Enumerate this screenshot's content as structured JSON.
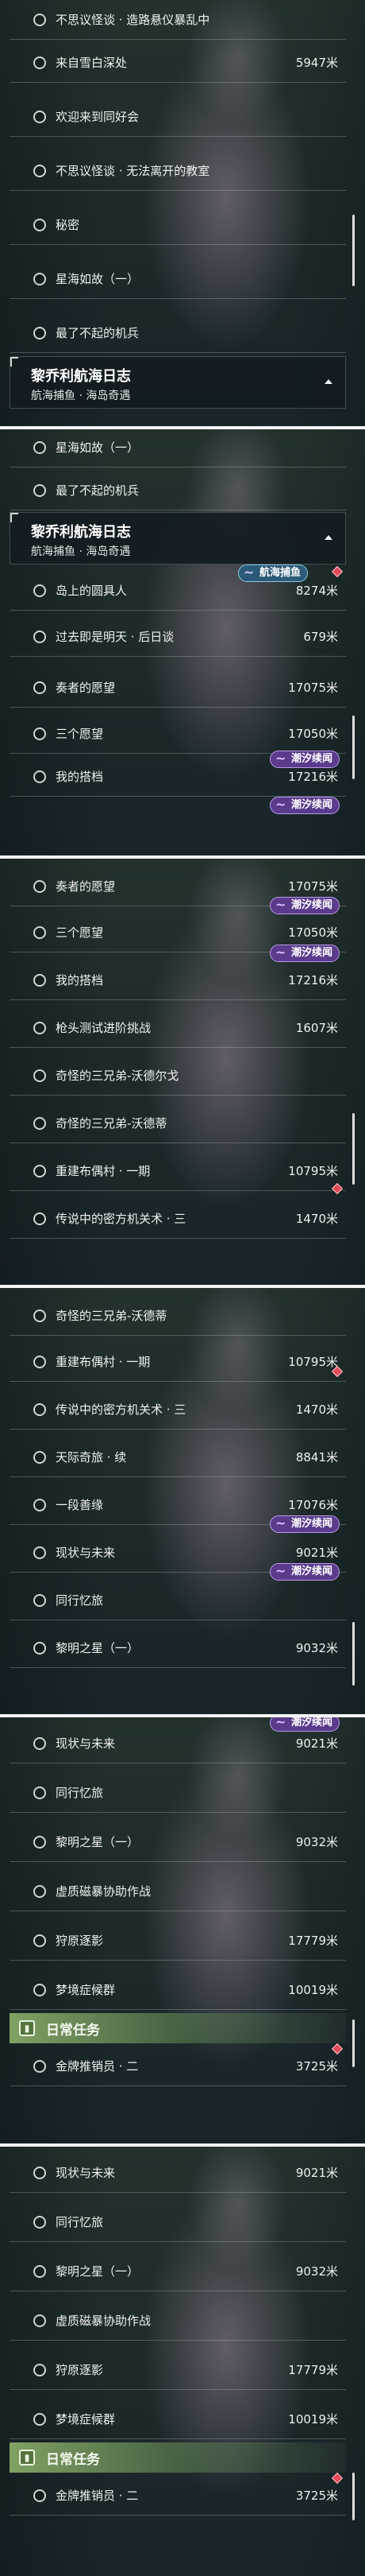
{
  "header": {
    "title": "黎乔利航海日志",
    "subtitle": "航海捕鱼 · 海岛奇遇"
  },
  "daily_title": "日常任务",
  "tags": {
    "chaoxi": "潮汐续闻",
    "hanghai": "航海捕鱼"
  },
  "icons": {
    "daily": "task-book-icon",
    "collapse": "chevron-up-icon",
    "radio": "radio-circle-icon",
    "new": "red-diamond-badge"
  },
  "colors": {
    "tag_purple": "#5a3b8c",
    "tag_blue": "#2b5a78",
    "badge_red": "#e04a5a",
    "daily_green": "#a5cd78"
  },
  "shots": [
    {
      "rows": [
        {
          "label": "不思议怪谈 · 造路悬仪暴乱中",
          "dist": ""
        },
        {
          "label": "来自雪白深处",
          "dist": "5947米"
        },
        {
          "label": "欢迎来到同好会",
          "dist": ""
        },
        {
          "label": "不思议怪谈 · 无法离开的教室",
          "dist": ""
        },
        {
          "label": "秘密",
          "dist": ""
        },
        {
          "label": "星海如故（一）",
          "dist": ""
        },
        {
          "label": "最了不起的机兵",
          "dist": ""
        },
        {
          "label": "星海如故（一）",
          "dist": ""
        },
        {
          "label": "最了不起的机兵",
          "dist": ""
        }
      ]
    },
    {
      "rows": [
        {
          "label": "岛上的圆具人",
          "dist": "8274米"
        },
        {
          "label": "过去即是明天 · 后日谈",
          "dist": "679米"
        },
        {
          "label": "奏者的愿望",
          "dist": "17075米"
        },
        {
          "label": "三个愿望",
          "dist": "17050米"
        },
        {
          "label": "我的搭档",
          "dist": "17216米"
        }
      ]
    },
    {
      "rows": [
        {
          "label": "奏者的愿望",
          "dist": "17075米"
        },
        {
          "label": "三个愿望",
          "dist": "17050米"
        },
        {
          "label": "我的搭档",
          "dist": "17216米"
        },
        {
          "label": "枪头测试进阶挑战",
          "dist": "1607米"
        },
        {
          "label": "奇怪的三兄弟-沃德尔戈",
          "dist": ""
        },
        {
          "label": "奇怪的三兄弟-沃德蒂",
          "dist": ""
        },
        {
          "label": "重建布偶村 · 一期",
          "dist": "10795米"
        },
        {
          "label": "传说中的密方机关术 · 三",
          "dist": "1470米"
        }
      ]
    },
    {
      "rows": [
        {
          "label": "奇怪的三兄弟-沃德蒂",
          "dist": ""
        },
        {
          "label": "重建布偶村 · 一期",
          "dist": "10795米"
        },
        {
          "label": "传说中的密方机关术 · 三",
          "dist": "1470米"
        },
        {
          "label": "天际奇旅 · 续",
          "dist": "8841米"
        },
        {
          "label": "一段善缘",
          "dist": "17076米"
        },
        {
          "label": "现状与未来",
          "dist": "9021米"
        },
        {
          "label": "同行忆旅",
          "dist": ""
        },
        {
          "label": "黎明之星（一）",
          "dist": "9032米"
        }
      ]
    },
    {
      "rows": [
        {
          "label": "现状与未来",
          "dist": "9021米"
        },
        {
          "label": "同行忆旅",
          "dist": ""
        },
        {
          "label": "黎明之星（一）",
          "dist": "9032米"
        },
        {
          "label": "虚质磁暴协助作战",
          "dist": ""
        },
        {
          "label": "狩原逐影",
          "dist": "17779米"
        },
        {
          "label": "梦境症候群",
          "dist": "10019米"
        },
        {
          "label": "金牌推销员 · 二",
          "dist": "3725米"
        }
      ]
    },
    {
      "rows": [
        {
          "label": "现状与未来",
          "dist": "9021米"
        },
        {
          "label": "同行忆旅",
          "dist": ""
        },
        {
          "label": "黎明之星（一）",
          "dist": "9032米"
        },
        {
          "label": "虚质磁暴协助作战",
          "dist": ""
        },
        {
          "label": "狩原逐影",
          "dist": "17779米"
        },
        {
          "label": "梦境症候群",
          "dist": "10019米"
        },
        {
          "label": "金牌推销员 · 二",
          "dist": "3725米"
        }
      ]
    }
  ]
}
